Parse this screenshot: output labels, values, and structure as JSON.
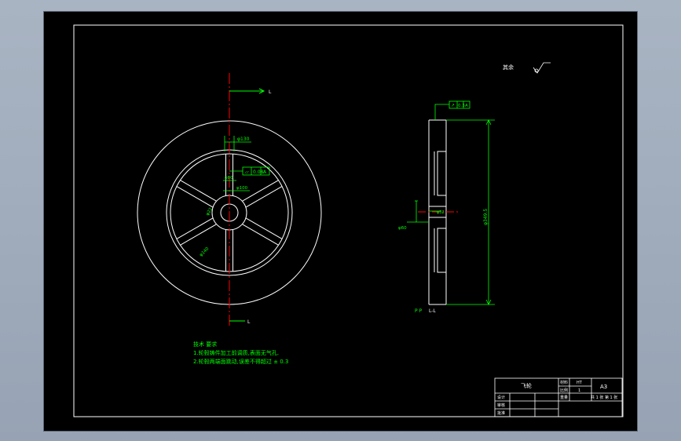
{
  "section_label": "L",
  "view_label": "L-L",
  "section_markers": "P  P",
  "surface_note": "其余",
  "front_dims": {
    "width_top": "φ130",
    "flatness": "0.08",
    "flatness_datum": "A",
    "hub_dim1": "φ80",
    "hub_dim2": "φ100",
    "bore_dim": "φ22",
    "rim_dim": "φ140"
  },
  "side_dims": {
    "runout": "0.3",
    "runout_datum": "A",
    "outer_diameter": "φ349.5",
    "hub_diameter": "φ60",
    "bore_label": "φ32"
  },
  "tech_req": {
    "title": "技术 要求",
    "line1": "1.轮毂铸件加工前调质,表面无气孔.",
    "line2": "2.轮毂两端面跳动,误差不得超过 ± 0.3"
  },
  "title_block": {
    "part_name": "飞轮",
    "material_label": "材料",
    "material": "HT",
    "scale_label": "比例",
    "scale": "1",
    "sheet_size": "A3",
    "weight_label": "重量",
    "sheets": "共 1 张 第 1 张",
    "designer_label": "设计",
    "checker_label": "审核",
    "approver_label": "批准"
  },
  "colors": {
    "outline": "#ffffff",
    "dimension": "#00ff00",
    "centerline": "#ff0000",
    "background": "#000000"
  }
}
